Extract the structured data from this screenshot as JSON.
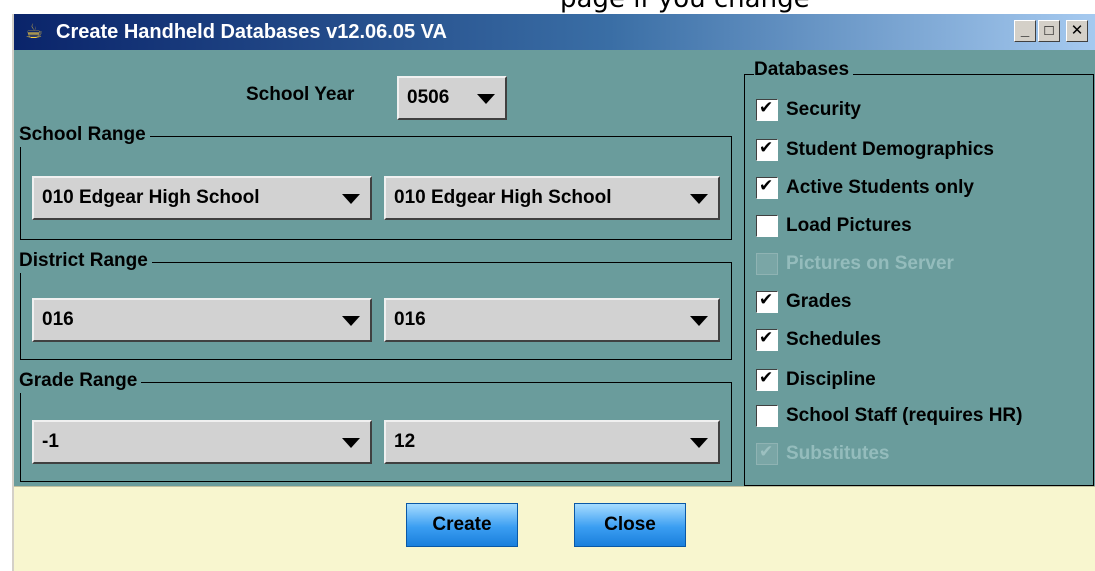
{
  "background_text": "page if you change",
  "window": {
    "title": "Create Handheld Databases   v12.06.05 VA",
    "controls": {
      "minimize": "_",
      "maximize": "□",
      "close": "✕"
    }
  },
  "school_year": {
    "label": "School Year",
    "value": "0506"
  },
  "school_range": {
    "title": "School Range",
    "from": "010 Edgear High School",
    "to": "010 Edgear High School"
  },
  "district_range": {
    "title": "District Range",
    "from": "016",
    "to": "016"
  },
  "grade_range": {
    "title": "Grade Range",
    "from": "-1",
    "to": "12"
  },
  "databases": {
    "title": "Databases",
    "items": [
      {
        "label": "Security",
        "checked": true,
        "enabled": true
      },
      {
        "label": "Student Demographics",
        "checked": true,
        "enabled": true
      },
      {
        "label": "Active Students only",
        "checked": true,
        "enabled": true
      },
      {
        "label": "Load Pictures",
        "checked": false,
        "enabled": true
      },
      {
        "label": "Pictures on Server",
        "checked": false,
        "enabled": false
      },
      {
        "label": "Grades",
        "checked": true,
        "enabled": true
      },
      {
        "label": "Schedules",
        "checked": true,
        "enabled": true
      },
      {
        "label": "Discipline",
        "checked": true,
        "enabled": true
      },
      {
        "label": "School Staff (requires HR)",
        "checked": false,
        "enabled": true
      },
      {
        "label": "Substitutes",
        "checked": true,
        "enabled": false
      }
    ]
  },
  "buttons": {
    "create": "Create",
    "close": "Close"
  },
  "colors": {
    "panel": "#6a9c9c",
    "footer": "#f8f6cf",
    "button": "#3b9ef2"
  }
}
